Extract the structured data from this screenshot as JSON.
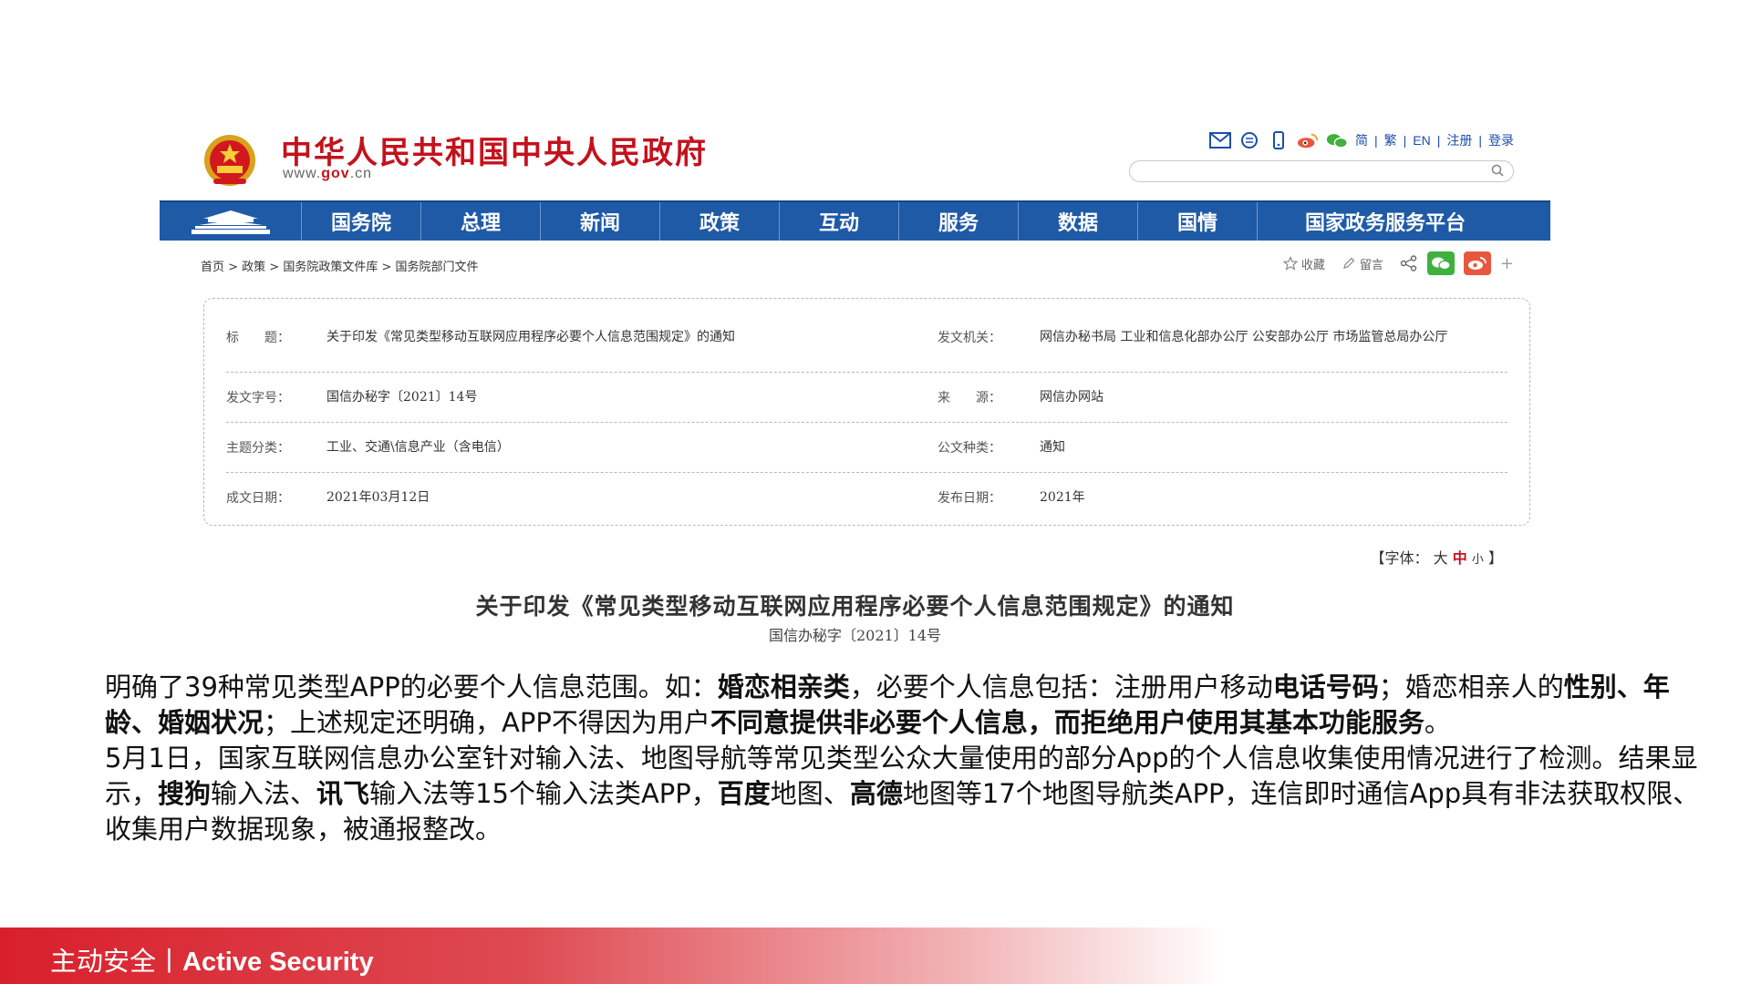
{
  "header": {
    "site_title": "中华人民共和国中央人民政府",
    "site_url_prefix": "www.",
    "site_url_brand": "gov",
    "site_url_suffix": ".cn",
    "top_links": [
      "简",
      "繁",
      "EN",
      "注册",
      "登录"
    ],
    "search_placeholder": ""
  },
  "nav": {
    "items": [
      "国务院",
      "总理",
      "新闻",
      "政策",
      "互动",
      "服务",
      "数据",
      "国情",
      "国家政务服务平台"
    ]
  },
  "breadcrumb": "首页 > 政策 > 国务院政策文件库 > 国务院部门文件",
  "share": {
    "favorite_label": "收藏",
    "comment_label": "留言",
    "more_symbol": "+"
  },
  "meta": {
    "title_label": "标　　题：",
    "title_value": "关于印发《常见类型移动互联网应用程序必要个人信息范围规定》的通知",
    "issuer_label": "发文机关：",
    "issuer_value": "网信办秘书局 工业和信息化部办公厅 公安部办公厅 市场监管总局办公厅",
    "docno_label": "发文字号：",
    "docno_value": "国信办秘字〔2021〕14号",
    "source_label": "来　　源：",
    "source_value": "网信办网站",
    "topic_label": "主题分类：",
    "topic_value": "工业、交通\\信息产业（含电信）",
    "doctype_label": "公文种类：",
    "doctype_value": "通知",
    "written_label": "成文日期：",
    "written_value": "2021年03月12日",
    "published_label": "发布日期：",
    "published_value": "2021年"
  },
  "font_size": {
    "prefix": "【字体：",
    "large": "大",
    "medium": "中",
    "small": "小",
    "suffix": "】"
  },
  "document": {
    "title": "关于印发《常见类型移动互联网应用程序必要个人信息范围规定》的通知",
    "number": "国信办秘字〔2021〕14号"
  },
  "body": {
    "p1": {
      "a": "明确了39种常见类型APP的必要个人信息范围。如：",
      "b1": "婚恋相亲类",
      "c": "，必要个人信息包括：注册用户移动",
      "b2": "电话号码",
      "d": "；婚恋相亲人的",
      "b3": "性别、年龄、婚姻状况",
      "e": "；上述规定还明确，APP不得因为用户",
      "b4": "不同意提供非必要个人信息，而拒绝用户使用其基本功能服务",
      "f": "。"
    },
    "p2": {
      "a": "5月1日，国家互联网信息办公室针对输入法、地图导航等常见类型公众大量使用的部分App的个人信息收集使用情况进行了检测。结果显示，",
      "b1": "搜狗",
      "c": "输入法、",
      "b2": "讯飞",
      "d": "输入法等15个输入法类APP，",
      "b3": "百度",
      "e": "地图、",
      "b4": "高德",
      "f": "地图等17个地图导航类APP，连信即时通信App具有非法获取权限、收集用户数据现象，被通报整改。"
    }
  },
  "footer": {
    "cn": "主动安全",
    "sep": "丨",
    "en": "Active Security"
  },
  "icons": [
    "mail-icon",
    "message-icon",
    "mobile-icon",
    "weibo-icon",
    "wechat-icon",
    "search-icon",
    "star-icon",
    "pen-icon",
    "share-icon"
  ],
  "colors": {
    "brand_red": "#c4121d",
    "nav_blue": "#1f5aa6",
    "link_blue": "#1c4fa8",
    "wechat_green": "#3fb13f",
    "weibo_red": "#e8573d"
  }
}
